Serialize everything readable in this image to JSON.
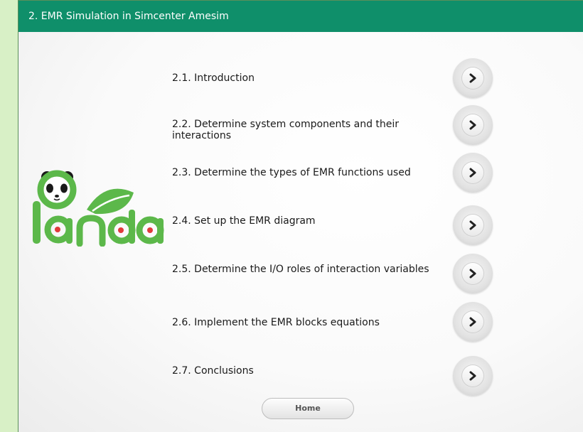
{
  "header": {
    "title": "2. EMR Simulation in Simcenter Amesim"
  },
  "logo": {
    "text": "Panda"
  },
  "menu": {
    "items": [
      {
        "label": "2.1. Introduction"
      },
      {
        "label": "2.2. Determine system components and their interactions"
      },
      {
        "label": "2.3. Determine the types of EMR functions used"
      },
      {
        "label": "2.4. Set up the EMR diagram"
      },
      {
        "label": "2.5. Determine the I/O roles of interaction variables"
      },
      {
        "label": "2.6. Implement the EMR blocks equations"
      },
      {
        "label": "2.7. Conclusions"
      }
    ]
  },
  "footer": {
    "home_label": "Home"
  },
  "colors": {
    "header": "#0f8f6a",
    "logo_green": "#5cb84a",
    "background": "#d8f0c6"
  },
  "icons": {
    "menu_button": "chevron-right-icon",
    "logo": "panda-logo"
  }
}
